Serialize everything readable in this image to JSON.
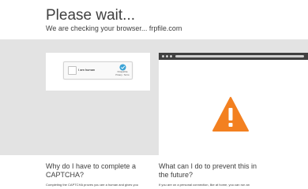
{
  "header": {
    "title": "Please wait...",
    "subtitle": "We are checking your browser... frpfile.com"
  },
  "captcha": {
    "checkbox_label": "I am human",
    "brand": "hCaptcha",
    "links": "Privacy - Terms"
  },
  "browser_mock": {
    "icon": "warning-icon"
  },
  "faq": {
    "q1": "Why do I have to complete a CAPTCHA?",
    "a1": "Completing the CAPTCHA proves you are a human and gives you",
    "q2": "What can I do to prevent this in the future?",
    "a2": "If you are on a personal connection, like at home, you can run an"
  },
  "colors": {
    "band": "#e3e3e3",
    "warning": "#f38020",
    "browser_bar": "#404040",
    "text": "#404040"
  }
}
